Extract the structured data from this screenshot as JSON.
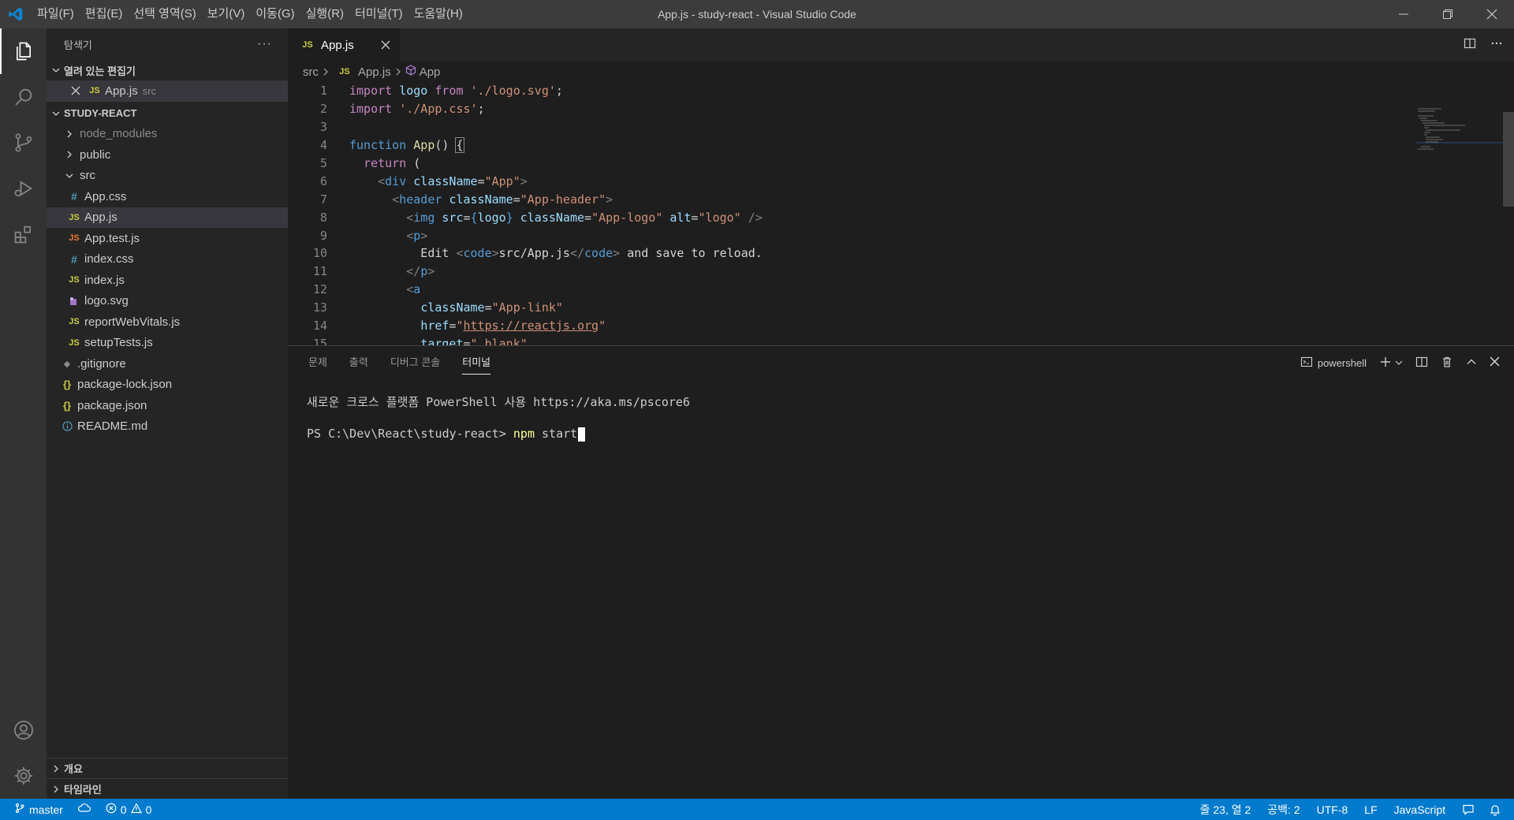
{
  "window": {
    "title": "App.js - study-react - Visual Studio Code",
    "menu": [
      "파일(F)",
      "편집(E)",
      "선택 영역(S)",
      "보기(V)",
      "이동(G)",
      "실행(R)",
      "터미널(T)",
      "도움말(H)"
    ]
  },
  "sidebar": {
    "title": "탐색기",
    "more": "···",
    "open_editors_label": "열려 있는 편집기",
    "open_editor": {
      "name": "App.js",
      "folder": "src"
    },
    "project_label": "STUDY-REACT",
    "tree": [
      {
        "name": "node_modules",
        "kind": "folder",
        "open": false
      },
      {
        "name": "public",
        "kind": "folder",
        "open": false
      },
      {
        "name": "src",
        "kind": "folder",
        "open": true
      },
      {
        "name": "App.css",
        "kind": "css"
      },
      {
        "name": "App.js",
        "kind": "js",
        "selected": true
      },
      {
        "name": "App.test.js",
        "kind": "jstest"
      },
      {
        "name": "index.css",
        "kind": "css"
      },
      {
        "name": "index.js",
        "kind": "js"
      },
      {
        "name": "logo.svg",
        "kind": "svg"
      },
      {
        "name": "reportWebVitals.js",
        "kind": "js"
      },
      {
        "name": "setupTests.js",
        "kind": "js"
      },
      {
        "name": ".gitignore",
        "kind": "git"
      },
      {
        "name": "package-lock.json",
        "kind": "json"
      },
      {
        "name": "package.json",
        "kind": "json"
      },
      {
        "name": "README.md",
        "kind": "info"
      }
    ],
    "outline_label": "개요",
    "timeline_label": "타임라인"
  },
  "editor": {
    "tab": {
      "name": "App.js",
      "icon_text": "JS"
    },
    "breadcrumb": [
      "src",
      "App.js",
      "App"
    ],
    "line_numbers": [
      "1",
      "2",
      "3",
      "4",
      "5",
      "6",
      "7",
      "8",
      "9",
      "10",
      "11",
      "12",
      "13",
      "14",
      "15"
    ]
  },
  "panel": {
    "tabs": [
      "문제",
      "출력",
      "디버그 콘솔",
      "터미널"
    ],
    "active_tab": "터미널",
    "shell_name": "powershell",
    "terminal_lines": {
      "banner": "새로운 크로스 플랫폼 PowerShell 사용 https://aka.ms/pscore6",
      "prompt": "PS C:\\Dev\\React\\study-react>",
      "command": "npm",
      "argument": "start"
    }
  },
  "status": {
    "branch": "master",
    "errors": "0",
    "warnings": "0",
    "position": "줄 23, 열 2",
    "indent": "공백: 2",
    "encoding": "UTF-8",
    "eol": "LF",
    "language": "JavaScript"
  },
  "colors": {
    "accent": "#007acc",
    "titlebar": "#3c3c3c",
    "activitybar": "#333333",
    "sidebar": "#252526",
    "editor": "#1e1e1e"
  }
}
